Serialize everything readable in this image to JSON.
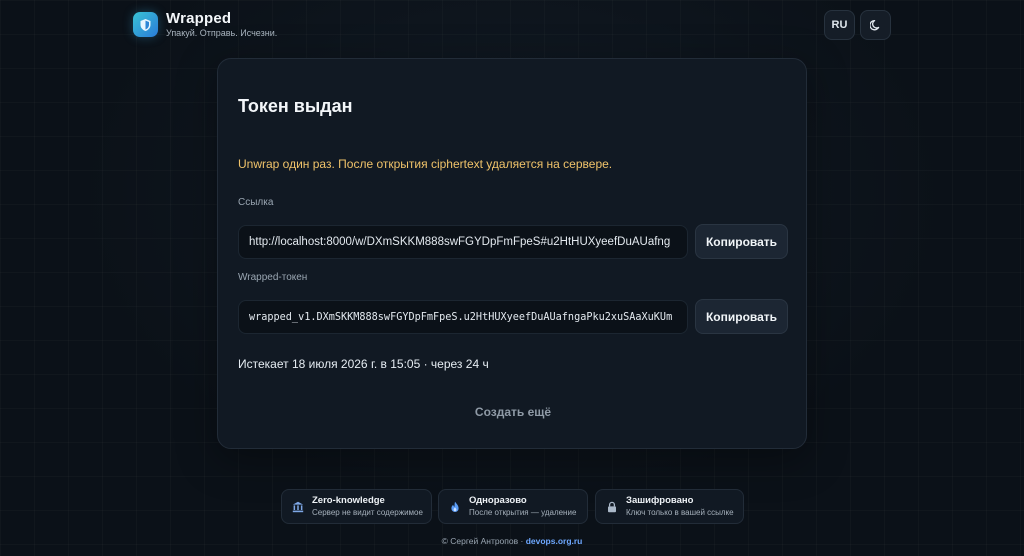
{
  "brand": {
    "title": "Wrapped",
    "subtitle": "Упакуй. Отправь. Исчезни.",
    "icon": "shield-icon",
    "gradient_from": "#39c3d6",
    "gradient_to": "#2a7bd8"
  },
  "header": {
    "lang_label": "RU",
    "theme_icon": "moon-icon"
  },
  "card": {
    "title": "Токен выдан",
    "warning": "Unwrap один раз. После открытия ciphertext удаляется на сервере.",
    "link_label": "Ссылка",
    "link_value": "http://localhost:8000/w/DXmSKKM888swFGYDpFmFpeS#u2HtHUXyeefDuAUafng",
    "token_label": "Wrapped-токен",
    "token_value": "wrapped_v1.DXmSKKM888swFGYDpFmFpeS.u2HtHUXyeefDuAUafngaPku2xuSAaXuKUm",
    "copy_label": "Копировать",
    "expires_text": "Истекает 18 июля 2026 г. в 15:05 · через 24 ч",
    "create_more": "Создать ещё"
  },
  "features": [
    {
      "icon": "bank-icon",
      "title": "Zero-knowledge",
      "desc": "Сервер не видит содержимое"
    },
    {
      "icon": "fire-icon",
      "title": "Одноразово",
      "desc": "После открытия — удаление"
    },
    {
      "icon": "lock-icon",
      "title": "Зашифровано",
      "desc": "Ключ только в вашей ссылке"
    }
  ],
  "footer": {
    "text": "© Сергей Антропов · ",
    "link": "devops.org.ru"
  },
  "colors": {
    "background": "#0b1118",
    "card": "#111923",
    "warning": "#f0c36a",
    "link": "#6ea8ff"
  }
}
